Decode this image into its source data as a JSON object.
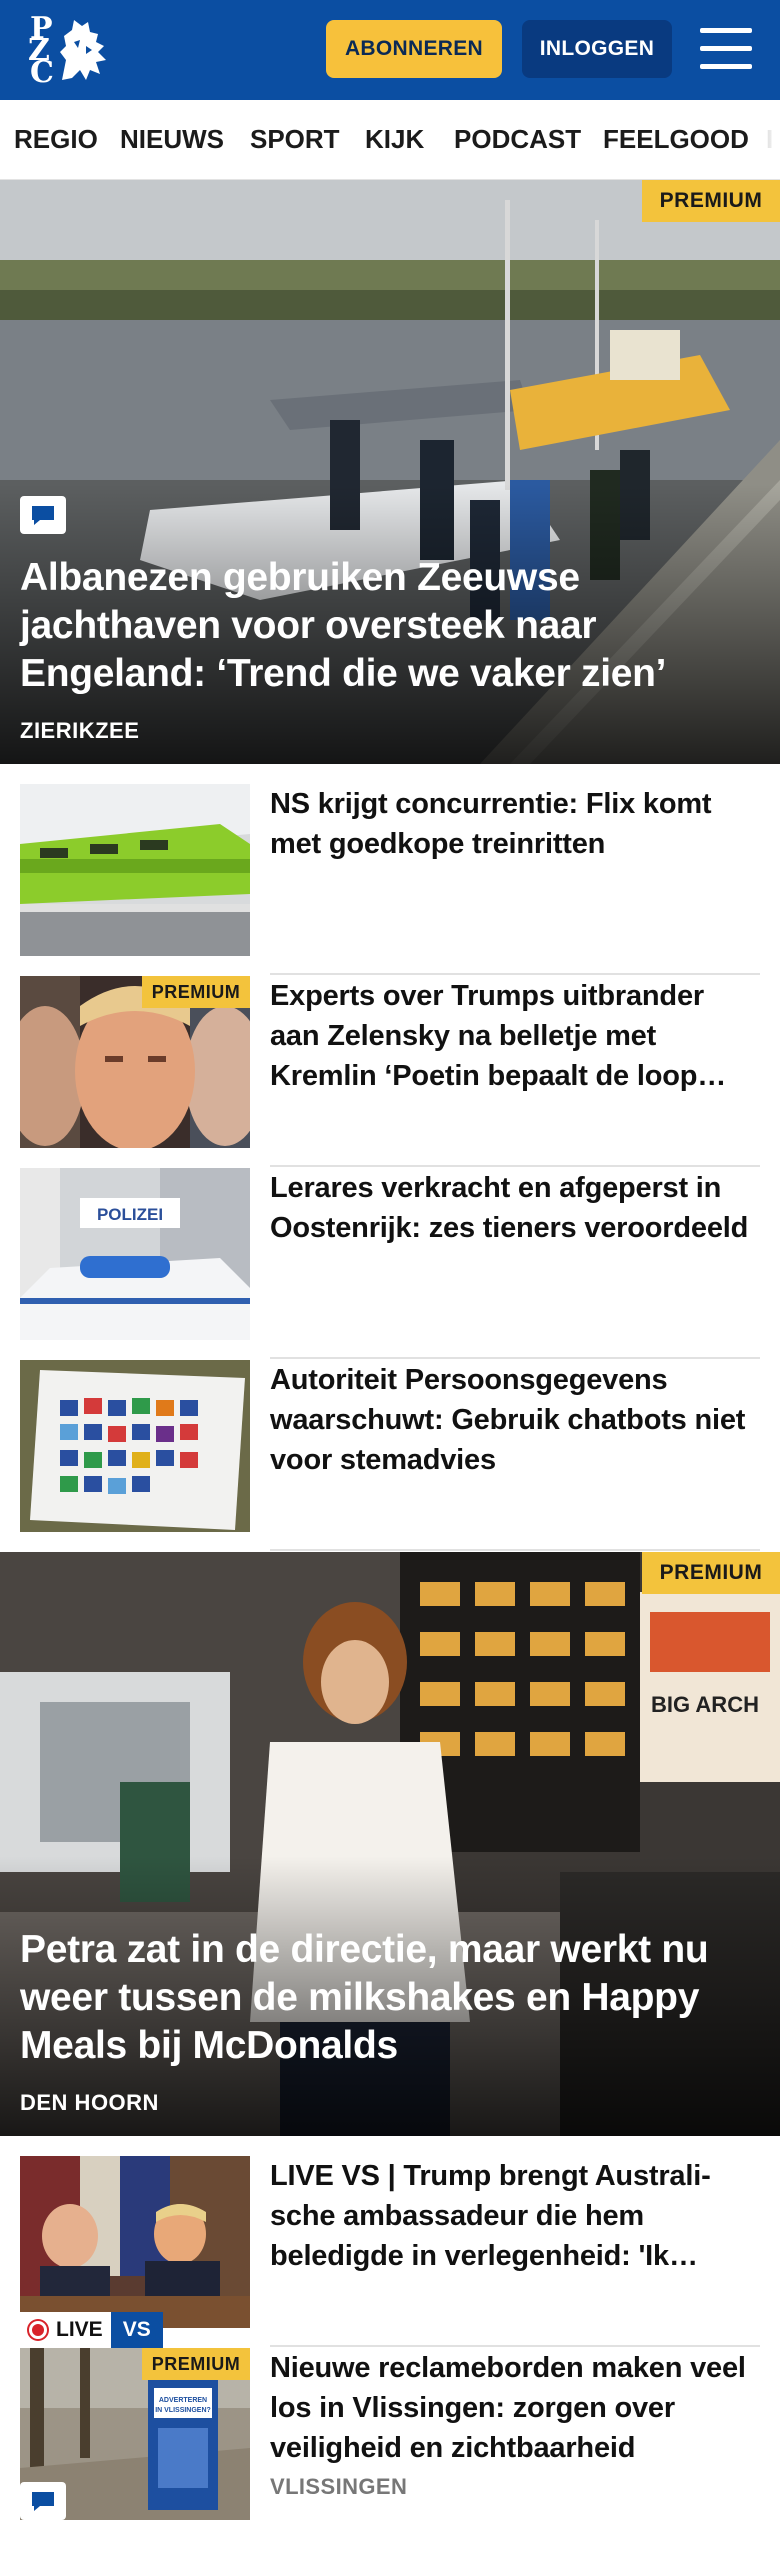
{
  "header": {
    "logo_letters": [
      "P",
      "Z",
      "C"
    ],
    "subscribe_label": "ABONNEREN",
    "login_label": "INLOGGEN",
    "menu_icon": "hamburger-icon",
    "colors": {
      "brand_blue": "#0b4ea2",
      "subscribe_yellow": "#f7c13b",
      "premium_yellow": "#f3c33c"
    }
  },
  "nav": {
    "items": [
      "REGIO",
      "NIEUWS",
      "SPORT",
      "KIJK",
      "PODCAST",
      "FEELGOOD",
      "I"
    ]
  },
  "hero1": {
    "badge": "PREMIUM",
    "title": "Albanezen gebruiken Zeeuwse jachthaven voor oversteek naar Engeland: ‘Trend die we vaker zien’",
    "location": "ZIERIKZEE",
    "icon": "comment-icon"
  },
  "articles": [
    {
      "title": "NS krijgt concurrentie: Flix komt met goedkope treinritten"
    },
    {
      "title": "Experts over Trumps uitbrander aan Zelensky na belletje met Kremlin ‘Poetin bepaalt de loop…",
      "badge": "PREMIUM"
    },
    {
      "title": "Lerares verkracht en afgeperst in Oostenrijk: zes tieners veroor­deeld",
      "thumb_text": "POLIZEI"
    },
    {
      "title": "Autoriteit Persoonsgegevens waarschuwt: Gebruik chatbots niet voor stemadvies"
    }
  ],
  "hero2": {
    "badge": "PREMIUM",
    "title": "Petra zat in de directie, maar werkt nu weer tussen de milkshakes en Happy Meals bij McDonalds",
    "location": "DEN HOORN",
    "sign_text": "BIG ARCH"
  },
  "articles2": [
    {
      "title": "LIVE VS | Trump brengt Australi­sche ambassadeur die hem beledigde in verlegenheid: 'Ik…",
      "live_label": "LIVE",
      "vs_label": "VS"
    },
    {
      "title": "Nieuwe reclameborden maken veel los in Vlissingen: zorgen over veiligheid en zichtbaarheid",
      "location": "VLISSINGEN",
      "badge": "PREMIUM",
      "icon": "comment-icon",
      "thumb_text": "ADVERTEREN IN VLISSINGEN?"
    }
  ]
}
